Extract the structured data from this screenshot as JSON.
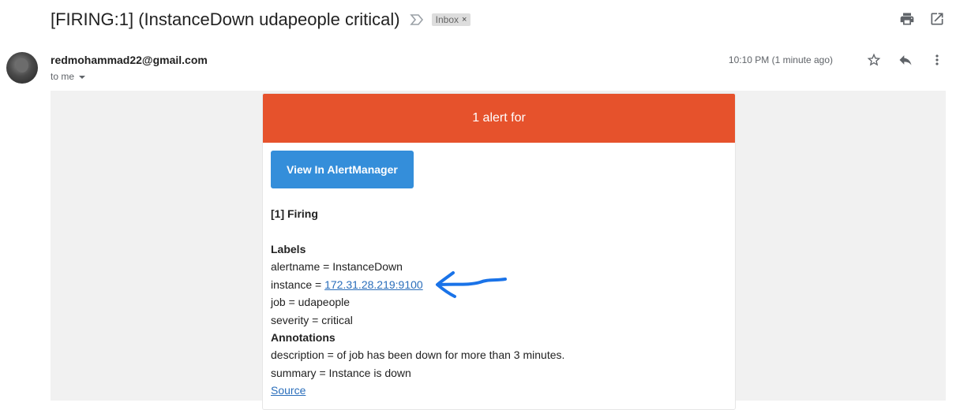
{
  "email": {
    "subject": "[FIRING:1] (InstanceDown udapeople critical)",
    "label_chip": "Inbox",
    "label_chip_remove": "×",
    "sender": "redmohammad22@gmail.com",
    "recipient_line": "to me",
    "timestamp": "10:10 PM (1 minute ago)"
  },
  "icons": {
    "importance": "importance-marker-icon",
    "print": "print-icon",
    "new_window": "open-in-new-window-icon",
    "star": "star-icon",
    "reply": "reply-icon",
    "more": "more-vertical-icon",
    "annotation_arrow": "hand-drawn-arrow-icon"
  },
  "alert": {
    "header": "1 alert for",
    "button_label": "View In AlertManager",
    "firing_heading": "[1] Firing",
    "labels_heading": "Labels",
    "alertname": "alertname = InstanceDown",
    "instance_prefix": "instance = ",
    "instance_link": "172.31.28.219:9100",
    "job": "job = udapeople",
    "severity": "severity = critical",
    "annotations_heading": "Annotations",
    "description": "description = of job has been down for more than 3 minutes.",
    "summary": "summary = Instance is down",
    "source_link": "Source"
  },
  "colors": {
    "alert_header": "#e6522c",
    "button": "#348eda",
    "link": "#2a6ebb",
    "arrow_annotation": "#1a73e8"
  }
}
